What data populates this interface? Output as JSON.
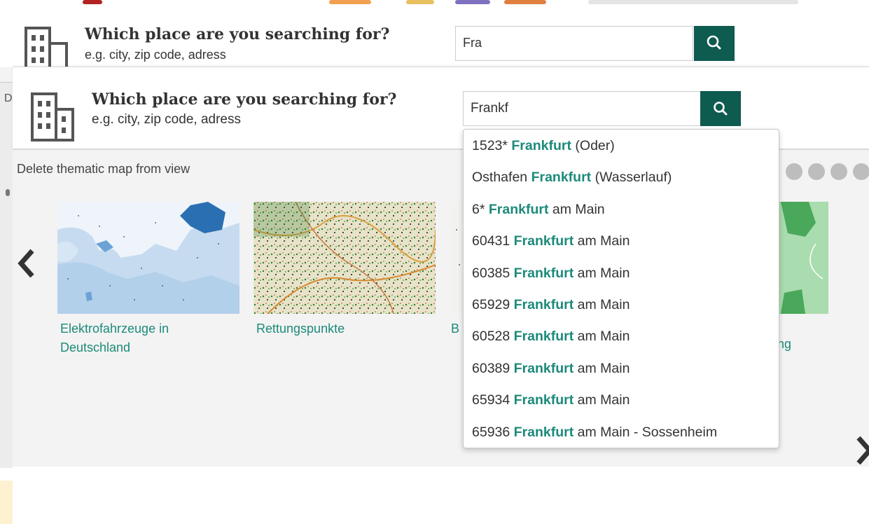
{
  "search": {
    "title": "Which place are you searching for?",
    "subtitle": "e.g. city, zip code, adress",
    "value": "Frankf",
    "button_icon": "search-icon"
  },
  "search_previous": {
    "title": "Which place are you searching for?",
    "subtitle": "e.g. city, zip code, adress",
    "value": "Fra"
  },
  "left_edge_text": "D",
  "thematic": {
    "delete_label": "Delete thematic map from view",
    "cards": [
      {
        "label": "Elektrofahrzeuge in Deutschland"
      },
      {
        "label": "Rettungspunkte"
      },
      {
        "label": "B"
      },
      {
        "label": "ng"
      }
    ]
  },
  "suggestions": [
    {
      "prefix": "1523* ",
      "match": "Frankfurt",
      "suffix": " (Oder)"
    },
    {
      "prefix": "Osthafen ",
      "match": "Frankfurt",
      "suffix": " (Wasserlauf)"
    },
    {
      "prefix": "6* ",
      "match": "Frankfurt",
      "suffix": " am Main"
    },
    {
      "prefix": "60431 ",
      "match": "Frankfurt",
      "suffix": " am Main"
    },
    {
      "prefix": "60385 ",
      "match": "Frankfurt",
      "suffix": " am Main"
    },
    {
      "prefix": "65929 ",
      "match": "Frankfurt",
      "suffix": " am Main"
    },
    {
      "prefix": "60528 ",
      "match": "Frankfurt",
      "suffix": " am Main"
    },
    {
      "prefix": "60389 ",
      "match": "Frankfurt",
      "suffix": " am Main"
    },
    {
      "prefix": "65934 ",
      "match": "Frankfurt",
      "suffix": " am Main"
    },
    {
      "prefix": "65936 ",
      "match": "Frankfurt",
      "suffix": " am Main - Sossenheim"
    }
  ],
  "colors": {
    "accent": "#0e5b50",
    "link": "#1c8a7a"
  }
}
